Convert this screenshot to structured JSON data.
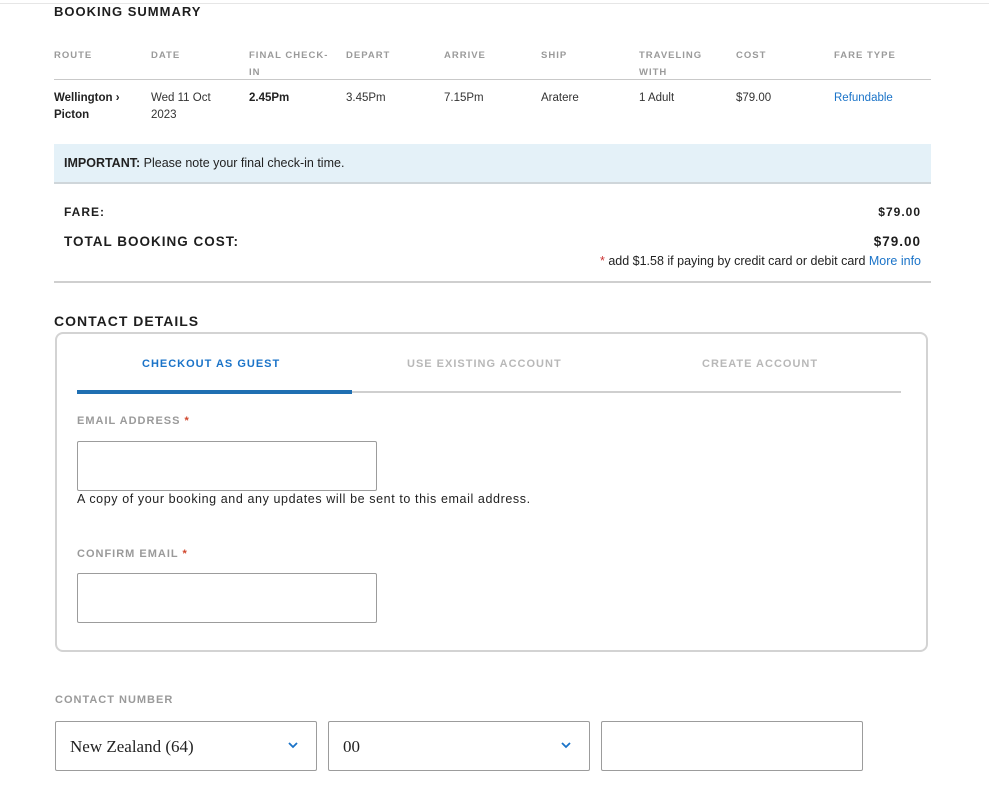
{
  "booking_summary": {
    "title": "BOOKING SUMMARY",
    "columns": [
      "ROUTE",
      "DATE",
      "FINAL CHECK-",
      "IN",
      "DEPART",
      "ARRIVE",
      "SHIP",
      "TRAVELING",
      "WITH",
      "COST",
      "FARE TYPE"
    ],
    "row": {
      "route_line1": "Wellington ›",
      "route_line2": "Picton",
      "date_line1": "Wed 11 Oct",
      "date_line2": "2023",
      "final_checkin": "2.45Pm",
      "depart": "3.45Pm",
      "arrive": "7.15Pm",
      "ship": "Aratere",
      "traveling_with": "1 Adult",
      "cost": "$79.00",
      "fare_type": "Refundable"
    }
  },
  "important": {
    "label": "IMPORTANT:",
    "text": " Please note your final check-in time."
  },
  "fare": {
    "label": "FARE:",
    "value": "$79.00",
    "total_label": "TOTAL BOOKING COST:",
    "total_value": "$79.00",
    "note_star": "*",
    "note_text": " add $1.58 if paying by credit card or debit card ",
    "note_link": "More info"
  },
  "contact_details": {
    "title": "CONTACT DETAILS",
    "tabs": [
      "CHECKOUT AS GUEST",
      "USE EXISTING ACCOUNT",
      "CREATE ACCOUNT"
    ],
    "email_label": "EMAIL ADDRESS",
    "required_mark": "*",
    "email_value": "",
    "email_help": "A copy of your booking and any updates will be sent to this email address.",
    "confirm_label": "CONFIRM EMAIL",
    "confirm_value": ""
  },
  "contact_number": {
    "label": "CONTACT NUMBER",
    "country": "New Zealand (64)",
    "area_code": "00",
    "number": ""
  },
  "colors": {
    "accent": "#1f6fb2",
    "link": "#1a73c8",
    "important_bg": "#e4f1f8",
    "required": "#d0452b"
  }
}
